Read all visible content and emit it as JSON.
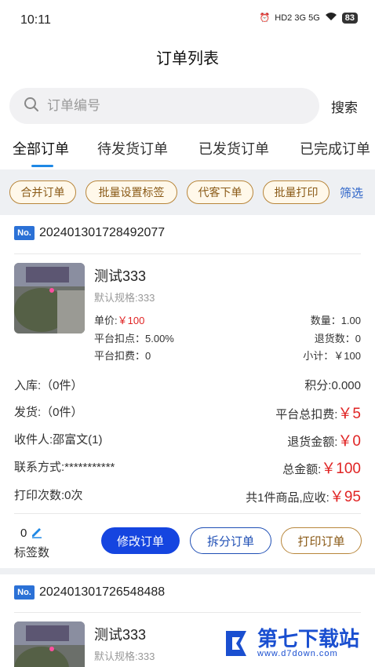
{
  "status_bar": {
    "time": "10:11",
    "network": "HD2 3G 5G",
    "battery": "83"
  },
  "page_title": "订单列表",
  "search": {
    "placeholder": "订单编号",
    "button_label": "搜索"
  },
  "tabs": [
    {
      "label": "全部订单",
      "active": true
    },
    {
      "label": "待发货订单",
      "active": false
    },
    {
      "label": "已发货订单",
      "active": false
    },
    {
      "label": "已完成订单",
      "active": false
    }
  ],
  "actions": {
    "merge": "合并订单",
    "batch_tag": "批量设置标签",
    "proxy_order": "代客下单",
    "batch_print": "批量打印",
    "filter": "筛选"
  },
  "orders": [
    {
      "badge": "No.",
      "order_no": "202401301728492077",
      "product": {
        "name": "测试333",
        "spec": "默认规格:333",
        "unit_price_label": "单价:",
        "unit_price": "￥100",
        "quantity": "数量：1.00",
        "platform_rate": "平台扣点：5.00%",
        "return_qty": "退货数：0",
        "platform_fee": "平台扣费：0",
        "subtotal": "小计：￥100"
      },
      "stock_in": "入库:（0件）",
      "points": "积分:0.000",
      "shipped": "发货:（0件）",
      "platform_total_fee_label": "平台总扣费:",
      "platform_total_fee": "￥5",
      "receiver": "收件人:邵富文(1)",
      "refund_label": "退货金额:",
      "refund": "￥0",
      "contact": "联系方式:***********",
      "total_label": "总金额:",
      "total": "￥100",
      "print_count": "打印次数:0次",
      "receivable_label": "共1件商品,应收:",
      "receivable": "￥95",
      "tag_count": "0",
      "tag_label": "标签数",
      "btn_modify": "修改订单",
      "btn_split": "拆分订单",
      "btn_print": "打印订单"
    },
    {
      "badge": "No.",
      "order_no": "202401301726548488",
      "product": {
        "name": "测试333",
        "spec": "默认规格:333"
      }
    }
  ],
  "watermark": {
    "text": "第七下载站",
    "url": "www.d7down.com"
  },
  "colors": {
    "accent_blue": "#1545e0",
    "tab_indicator": "#1e88e5",
    "gold": "#b8863b",
    "price_red": "#e02424"
  }
}
